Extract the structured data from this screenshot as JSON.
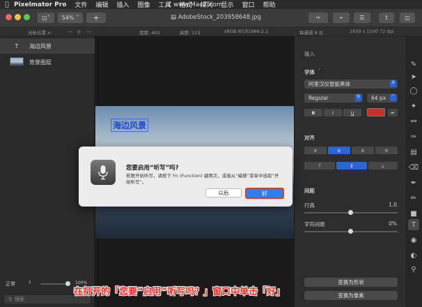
{
  "menubar": {
    "app_name": "Pixelmator Pro",
    "items": [
      "文件",
      "编辑",
      "插入",
      "图像",
      "工具",
      "格式",
      "排列",
      "显示",
      "窗口",
      "帮助"
    ]
  },
  "watermark": "Z  www.MacZ.com",
  "toolbar": {
    "zoom": "54%",
    "add": "+",
    "doc_title": "AdobeStock_203958648.jpg"
  },
  "infobar": {
    "cursor_x": "光标位置 x:",
    "cursor_x_val": "—",
    "cursor_y": "y:",
    "cursor_y_val": "—",
    "width": "宽度: 402",
    "height": "高度: 113",
    "profile": "sRGB IEC61966-2.1",
    "depth": "每通道 8 位",
    "dims": "1650 x 1100 72 dpi"
  },
  "layers": [
    {
      "name": "海边风景",
      "icon": "T"
    },
    {
      "name": "背景图层",
      "icon": "thumb"
    }
  ],
  "layers_footer": {
    "blend_mode": "正常",
    "opacity": "100%",
    "search_placeholder": "搜索"
  },
  "canvas": {
    "image_text": "海边风景"
  },
  "dialog": {
    "title": "您要启用“听写”吗?",
    "message": "若要开始听写，请按下 Fn (Function) 键两次，或者从“编辑”菜单中选取“开始听写”。",
    "later": "以后",
    "ok": "好"
  },
  "inspector": {
    "input_label": "输入",
    "font_section": "字体",
    "font_name": "阿里汉仪智能黑体",
    "font_style": "Regular",
    "font_size": "64 px",
    "bold": "B",
    "italic": "I",
    "underline": "U",
    "text_color": "#c4342a",
    "align_section": "对齐",
    "spacing_section": "间距",
    "line_height_label": "行高",
    "line_height_value": "1.0",
    "char_spacing_label": "字符间距",
    "char_spacing_value": "0%",
    "convert_shape": "变换为形状",
    "convert_pixels": "变换为像素"
  },
  "caption": "在打开的「您要“启用”听写吗？」窗口中单击「好」"
}
